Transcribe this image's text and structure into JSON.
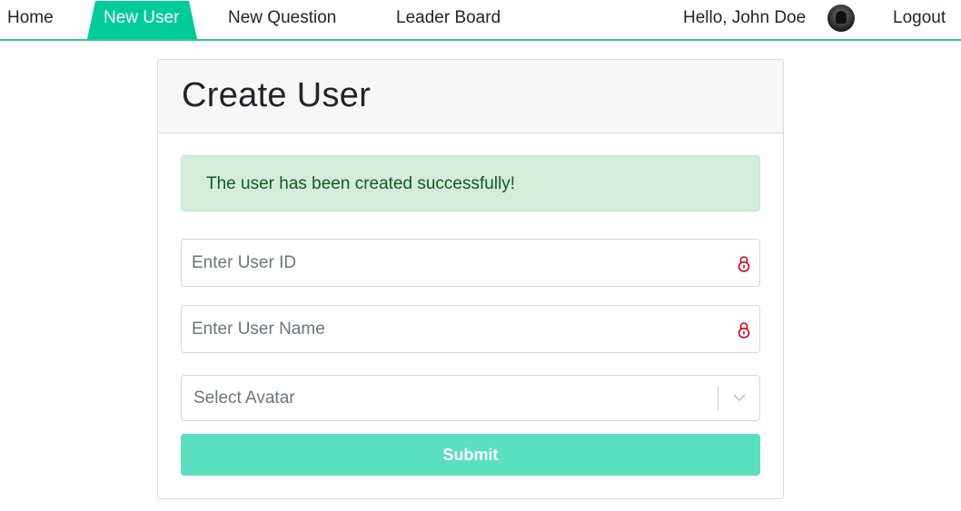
{
  "nav": {
    "home": "Home",
    "new_user": "New User",
    "new_question": "New Question",
    "leader_board": "Leader Board",
    "greeting": "Hello, John Doe",
    "avatar_icon": "user-avatar-icon",
    "logout": "Logout",
    "active_tab": "New User",
    "accent_color": "#00cc9a"
  },
  "card": {
    "title": "Create User",
    "alert": {
      "message": "The user has been created successfully!",
      "type": "success"
    },
    "form": {
      "user_id": {
        "value": "",
        "placeholder": "Enter User ID",
        "icon": "lock-icon"
      },
      "user_name": {
        "value": "",
        "placeholder": "Enter User Name",
        "icon": "lock-icon"
      },
      "avatar_select": {
        "placeholder": "Select Avatar",
        "icon": "chevron-down-icon"
      },
      "submit_label": "Submit"
    }
  },
  "colors": {
    "success_bg": "#d4edda",
    "success_text": "#155724",
    "submit_bg": "#5adfbf",
    "lock_icon": "#d0021b"
  }
}
